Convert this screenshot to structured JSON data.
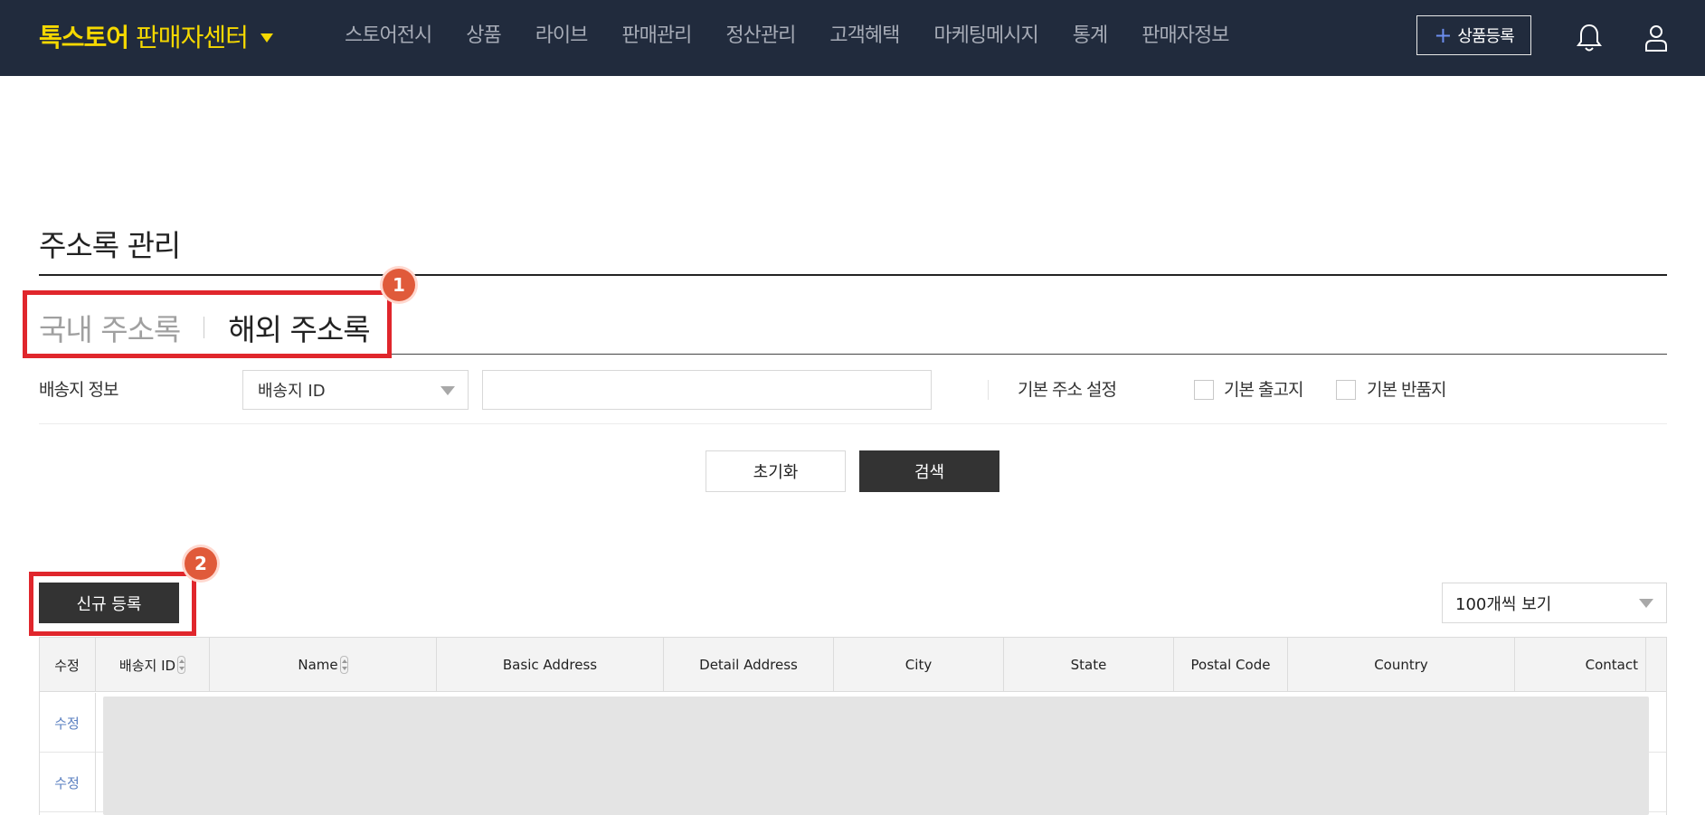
{
  "header": {
    "brand_main": "톡스토어",
    "brand_sub": "판매자센터",
    "nav": [
      "스토어전시",
      "상품",
      "라이브",
      "판매관리",
      "정산관리",
      "고객혜택",
      "마케팅메시지",
      "통계",
      "판매자정보"
    ],
    "register_label": "상품등록",
    "icons": [
      "chevron-down-icon",
      "plus-icon",
      "bell-icon",
      "user-icon"
    ]
  },
  "page": {
    "title": "주소록 관리"
  },
  "tabs": {
    "domestic": "국내 주소록",
    "overseas": "해외 주소록",
    "active": "overseas"
  },
  "annotations": {
    "badge1": "1",
    "badge2": "2",
    "color": "#e0262c"
  },
  "filter": {
    "label": "배송지 정보",
    "type_value": "배송지 ID",
    "search_value": "",
    "default_label": "기본 주소 설정",
    "checkbox_outbound": "기본 출고지",
    "checkbox_return": "기본 반품지",
    "outbound_checked": false,
    "return_checked": false
  },
  "buttons": {
    "reset": "초기화",
    "search": "검색",
    "new_register": "신규 등록"
  },
  "page_size": "100개씩 보기",
  "table": {
    "columns": [
      "수정",
      "배송지 ID",
      "Name",
      "Basic Address",
      "Detail Address",
      "City",
      "State",
      "Postal Code",
      "Country",
      "Contact"
    ],
    "rows": [
      {
        "edit": "수정"
      },
      {
        "edit": "수정"
      }
    ]
  },
  "colors": {
    "topbar": "#212b3d",
    "brand": "#f5d800",
    "dark_button": "#333333",
    "link": "#5a7fc0"
  }
}
